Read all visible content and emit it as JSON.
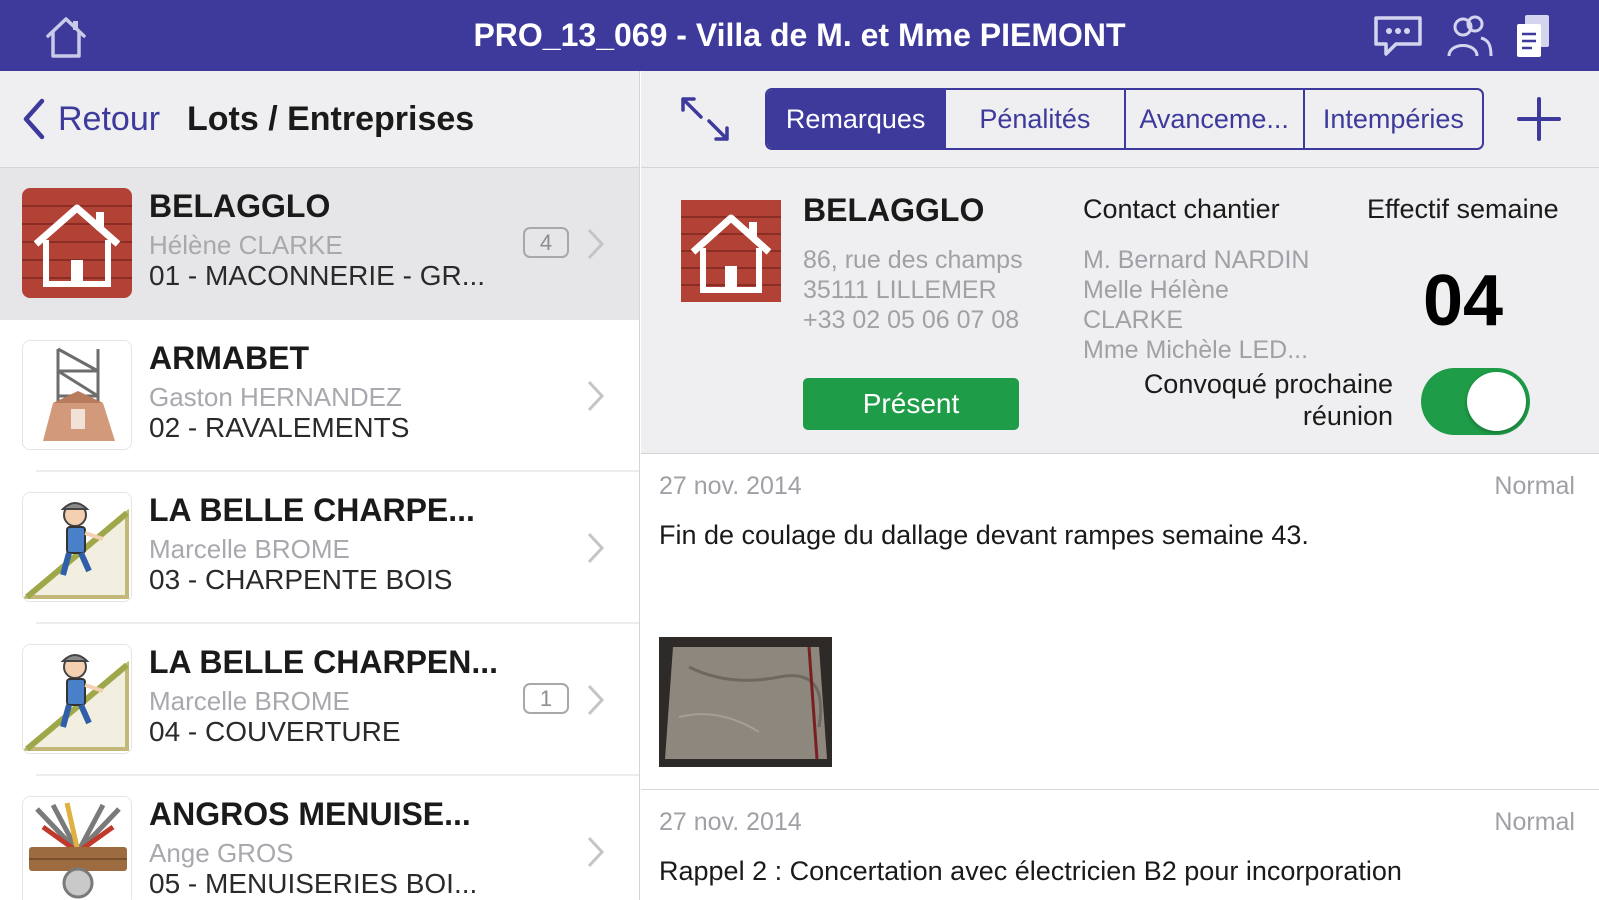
{
  "header": {
    "title": "PRO_13_069 - Villa de M. et Mme PIEMONT",
    "icons": [
      "home-icon",
      "chat-icon",
      "users-icon",
      "documents-icon"
    ]
  },
  "left_panel": {
    "back_label": "Retour",
    "title": "Lots / Entreprises",
    "items": [
      {
        "name": "BELAGGLO",
        "contact": "Hélène CLARKE",
        "lot": "01 - MACONNERIE - GR...",
        "badge": "4",
        "icon": "brick-house-icon",
        "selected": true
      },
      {
        "name": "ARMABET",
        "contact": "Gaston HERNANDEZ",
        "lot": "02 - RAVALEMENTS",
        "badge": "",
        "icon": "scaffolding-icon",
        "selected": false
      },
      {
        "name": "LA BELLE CHARPE...",
        "contact": "Marcelle BROME",
        "lot": "03 - CHARPENTE BOIS",
        "badge": "",
        "icon": "carpenter-icon",
        "selected": false
      },
      {
        "name": "LA BELLE CHARPEN...",
        "contact": "Marcelle BROME",
        "lot": "04 - COUVERTURE",
        "badge": "1",
        "icon": "carpenter-icon",
        "selected": false
      },
      {
        "name": "ANGROS MENUISE...",
        "contact": "Ange GROS",
        "lot": "05 - MENUISERIES BOI...",
        "badge": "",
        "icon": "tools-icon",
        "selected": false
      }
    ]
  },
  "tabs": {
    "items": [
      "Remarques",
      "Pénalités",
      "Avanceme...",
      "Intempéries"
    ],
    "active": "Remarques"
  },
  "detail": {
    "company": "BELAGGLO",
    "address_lines": [
      "86, rue des champs",
      "35111 LILLEMER",
      "+33 02 05 06 07 08"
    ],
    "contact_header": "Contact chantier",
    "contacts": [
      "M. Bernard NARDIN",
      "Melle Hélène",
      "CLARKE",
      "Mme Michèle LED..."
    ],
    "effectif_header": "Effectif semaine",
    "effectif_value": "04",
    "present_label": "Présent",
    "convoque_label_1": "Convoqué prochaine",
    "convoque_label_2": "réunion",
    "convoque_on": true
  },
  "remarks": [
    {
      "date": "27 nov. 2014",
      "priority": "Normal",
      "text": "Fin de coulage du dallage devant rampes semaine 43.",
      "has_photo": true
    },
    {
      "date": "27 nov. 2014",
      "priority": "Normal",
      "text": "Rappel 2 : Concertation avec électricien B2 pour incorporation",
      "has_photo": false
    }
  ],
  "colors": {
    "brand": "#3d3a9c",
    "success": "#1e9c47",
    "panel_bg": "#efeff1",
    "secondary_text": "#a0a0a6"
  }
}
